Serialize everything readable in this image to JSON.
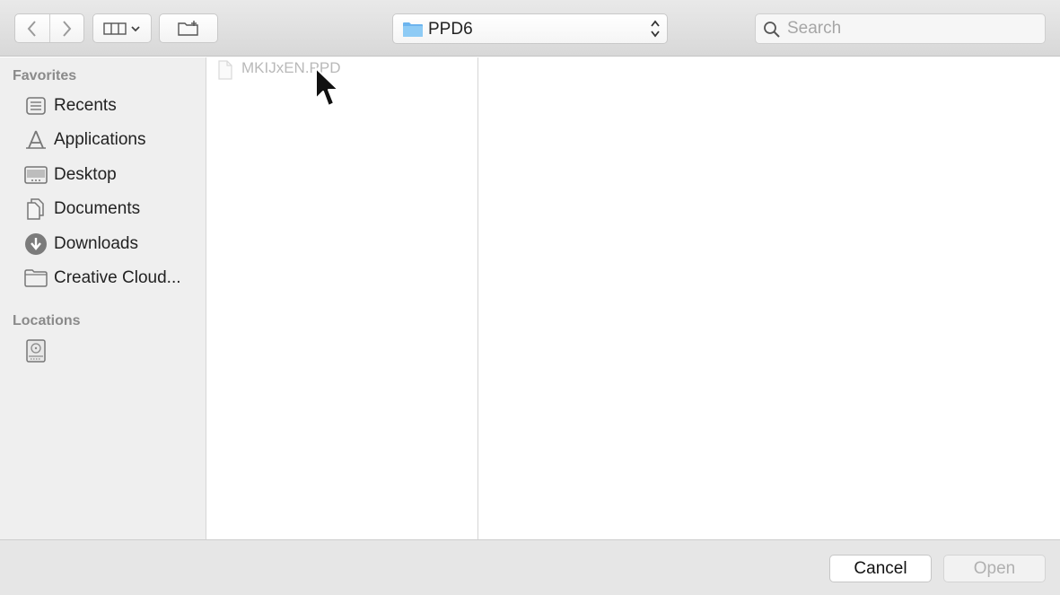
{
  "toolbar": {
    "back_icon": "chevron-left-icon",
    "forward_icon": "chevron-right-icon",
    "view_icon": "column-view-icon",
    "new_folder_icon": "new-folder-icon",
    "path_popup": {
      "label": "PPD6",
      "icon": "folder-icon"
    },
    "search": {
      "placeholder": "Search",
      "value": ""
    }
  },
  "sidebar": {
    "favorites_title": "Favorites",
    "items": [
      {
        "label": "Recents",
        "icon": "recents-icon"
      },
      {
        "label": "Applications",
        "icon": "applications-icon"
      },
      {
        "label": "Desktop",
        "icon": "desktop-icon"
      },
      {
        "label": "Documents",
        "icon": "documents-icon"
      },
      {
        "label": "Downloads",
        "icon": "downloads-icon"
      },
      {
        "label": "Creative Cloud...",
        "icon": "folder-icon"
      }
    ],
    "locations_title": "Locations",
    "locations": [
      {
        "label": "",
        "icon": "hard-drive-icon"
      }
    ]
  },
  "browser": {
    "files": [
      {
        "name": "MKIJxEN.PPD",
        "icon": "document-icon",
        "enabled": false
      }
    ]
  },
  "footer": {
    "cancel_label": "Cancel",
    "open_label": "Open"
  },
  "colors": {
    "folder_blue": "#6cb4ee",
    "disabled_text": "#b9b9b9"
  }
}
